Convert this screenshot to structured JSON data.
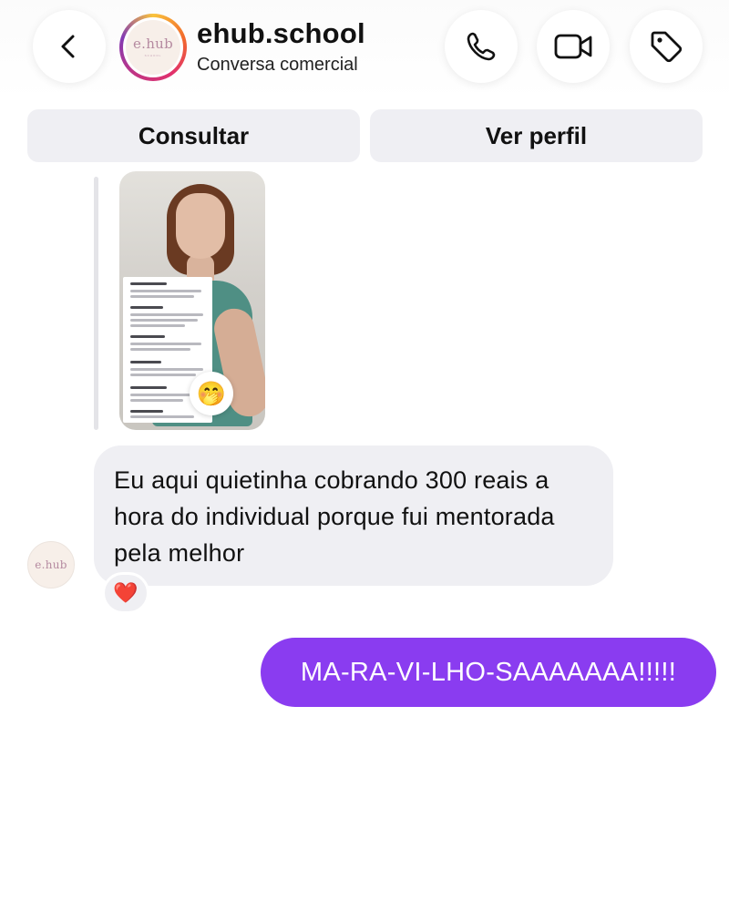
{
  "header": {
    "name": "ehub.school",
    "subtitle": "Conversa comercial",
    "avatar_logo": "e.hub",
    "avatar_logo_sub": "SCHOOL",
    "back_icon": "chevron-left-icon",
    "call_icon": "phone-icon",
    "video_icon": "video-camera-icon",
    "tag_icon": "tag-icon"
  },
  "actions": {
    "consult_label": "Consultar",
    "profile_label": "Ver perfil"
  },
  "thread": {
    "media_reaction_emoji": "🤭",
    "incoming_message": "Eu aqui quietinha cobrando 300 reais a hora do individual porque fui mentorada pela melhor",
    "incoming_reaction": "❤️",
    "sender_avatar_logo": "e.hub",
    "outgoing_message": "MA-RA-VI-LHO-SAAAAAAA!!!!!"
  },
  "colors": {
    "outgoing_bubble": "#8a3cf0",
    "incoming_bubble": "#efeff3",
    "action_button": "#efeff3"
  }
}
